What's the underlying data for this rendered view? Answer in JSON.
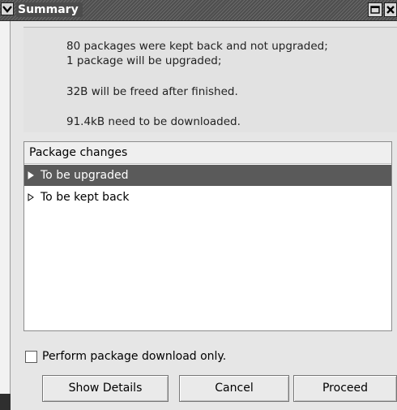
{
  "window": {
    "title": "Summary"
  },
  "summary": {
    "line1": "80 packages were kept back and not upgraded;",
    "line2": "1 package will be upgraded;",
    "line3": "32B will be freed after finished.",
    "line4": "91.4kB need to be downloaded."
  },
  "changes": {
    "header": "Package changes",
    "rows": [
      {
        "label": "To be upgraded",
        "selected": true
      },
      {
        "label": "To be kept back",
        "selected": false
      }
    ]
  },
  "options": {
    "download_only_label": "Perform package download only.",
    "download_only_checked": false
  },
  "buttons": {
    "details": "Show Details",
    "cancel": "Cancel",
    "proceed": "Proceed"
  }
}
